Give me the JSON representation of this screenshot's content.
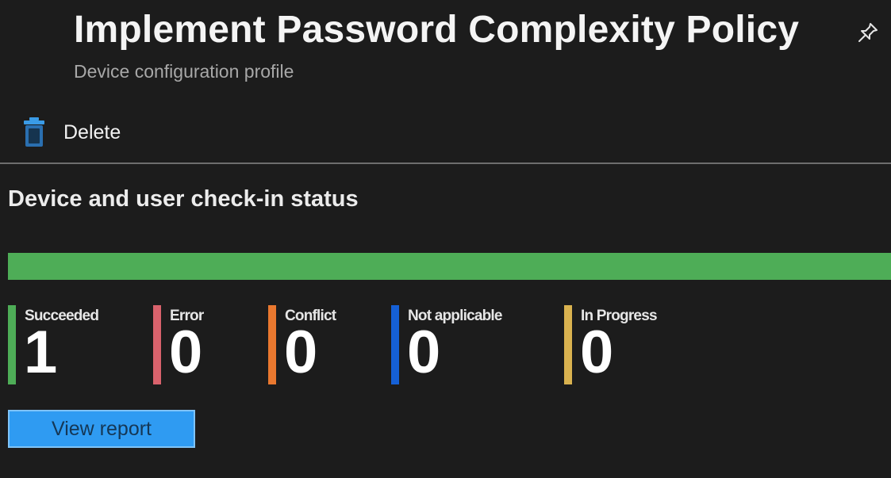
{
  "header": {
    "title": "Implement Password Complexity Policy",
    "subtitle": "Device configuration profile",
    "pin_icon": "pin-icon"
  },
  "toolbar": {
    "delete_label": "Delete",
    "delete_icon": "trash-icon"
  },
  "status": {
    "heading": "Device and user check-in status",
    "progress_succeeded_fraction": 1.0,
    "progress_color": "#4ead57",
    "stats": [
      {
        "label": "Succeeded",
        "value": "1",
        "color": "#4ead57"
      },
      {
        "label": "Error",
        "value": "0",
        "color": "#d9626c"
      },
      {
        "label": "Conflict",
        "value": "0",
        "color": "#e9782f"
      },
      {
        "label": "Not applicable",
        "value": "0",
        "color": "#1560d6"
      },
      {
        "label": "In Progress",
        "value": "0",
        "color": "#d9b24f"
      }
    ],
    "view_report_label": "View report"
  }
}
